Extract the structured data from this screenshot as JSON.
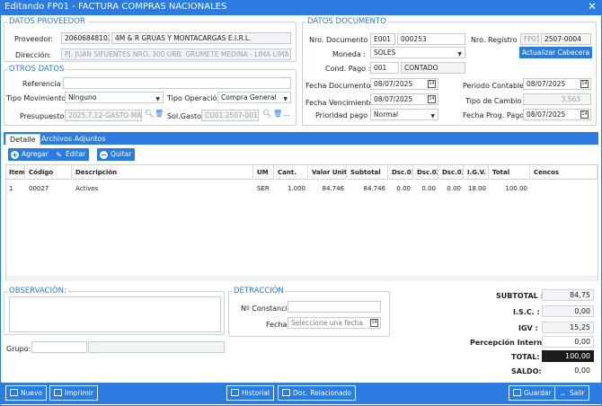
{
  "window": {
    "title": "Editando FP01 - FACTURA COMPRAS NACIONALES"
  },
  "proveedor": {
    "legend": "DATOS PROVEEDOR",
    "proveedor_label": "Proveedor:",
    "ruc": "20606848103",
    "nombre": "4M & R GRUAS Y MONTACARGAS E.I.R.L.",
    "direccion_label": "Dirección:",
    "direccion": "PJ. JUAN SIFUENTES NRO. 300 URB. GRUMETE MEDINA - LIMA LIMA ATE"
  },
  "otros": {
    "legend": "OTROS DATOS",
    "referencia_label": "Referencia :",
    "referencia": "",
    "tipo_mov_label": "Tipo Movimiento:",
    "tipo_mov": "Ninguno",
    "tipo_op_label": "Tipo Operación:",
    "tipo_op": "Compra General",
    "presupuesto_label": "Presupuesto:",
    "presupuesto": "2025.7.12-GASTO MARK",
    "solgasto_label": "Sol.Gasto:",
    "solgasto": "CU01.2507-0013-(",
    "ellipsis": "..."
  },
  "documento": {
    "legend": "DATOS DOCUMENTO",
    "nro_doc_label": "Nro. Documento :",
    "serie": "E001",
    "numero": "000253",
    "nro_reg_label": "Nro. Registro :",
    "reg_serie": "FP01",
    "reg_numero": "2507-0004",
    "moneda_label": "Moneda :",
    "moneda": "SOLES",
    "actualizar_label": "Actualizar Cabecera",
    "cond_pago_label": "Cond. Pago :",
    "cond_code": "001",
    "cond_desc": "CONTADO",
    "fecha_doc_label": "Fecha Documento :",
    "fecha_doc": "08/07/2025",
    "periodo_label": "Periodo Contable :",
    "periodo": "08/07/2025",
    "fecha_venc_label": "Fecha Vencimiento :",
    "fecha_venc": "08/07/2025",
    "tipo_cambio_label": "Tipo de Cambio :",
    "tipo_cambio": "3,563",
    "prioridad_label": "Prioridad pago :",
    "prioridad": "Normal",
    "fecha_prog_label": "Fecha Prog. Pago :",
    "fecha_prog": "08/07/2025"
  },
  "tabs": [
    {
      "label": "Detalle"
    },
    {
      "label": "Archivos Adjuntos"
    }
  ],
  "toolbar": {
    "agregar": "Agregar",
    "editar": "Editar",
    "quitar": "Quitar"
  },
  "grid": {
    "headers": [
      "Item",
      "Código",
      "Descripción",
      "UM",
      "Cant.",
      "Valor Unit.",
      "Subtotal",
      "Dsc.01",
      "Dsc.02",
      "Dsc.03",
      "I.G.V.",
      "Total",
      "Cencos"
    ],
    "rows": [
      [
        "1",
        "00027",
        "Activos",
        "SER",
        "1.000",
        "84.746",
        "84.746",
        "0.00",
        "0.00",
        "0.00",
        "18.00",
        "100.00",
        ""
      ]
    ]
  },
  "observacion": {
    "legend": "OBSERVACIÓN:"
  },
  "detraccion": {
    "legend": "DETRACCIÓN",
    "constancia_label": "Nº Constancia:",
    "fecha_label": "Fecha:",
    "fecha_placeholder": "Seleccione una fecha"
  },
  "grupo": {
    "label": "Grupo:"
  },
  "totales": {
    "subtotal_label": "SUBTOTAL :",
    "subtotal": "84,75",
    "isc_label": "I.S.C. :",
    "isc": "0,00",
    "igv_label": "IGV :",
    "igv": "15,25",
    "percepcion_label": "Percepción Interna :",
    "percepcion": "0,00",
    "total_label": "TOTAL:",
    "total": "100,00",
    "saldo_label": "SALDO:",
    "saldo": "0,00"
  },
  "footer": {
    "nuevo": "Nuevo",
    "imprimir": "Imprimir",
    "historial": "Historial",
    "doc_rel": "Doc. Relacionado",
    "guardar": "Guardar",
    "salir": "Salir"
  },
  "colors": {
    "accent": "#2b7be0",
    "total_bg": "#1c1c1c"
  }
}
